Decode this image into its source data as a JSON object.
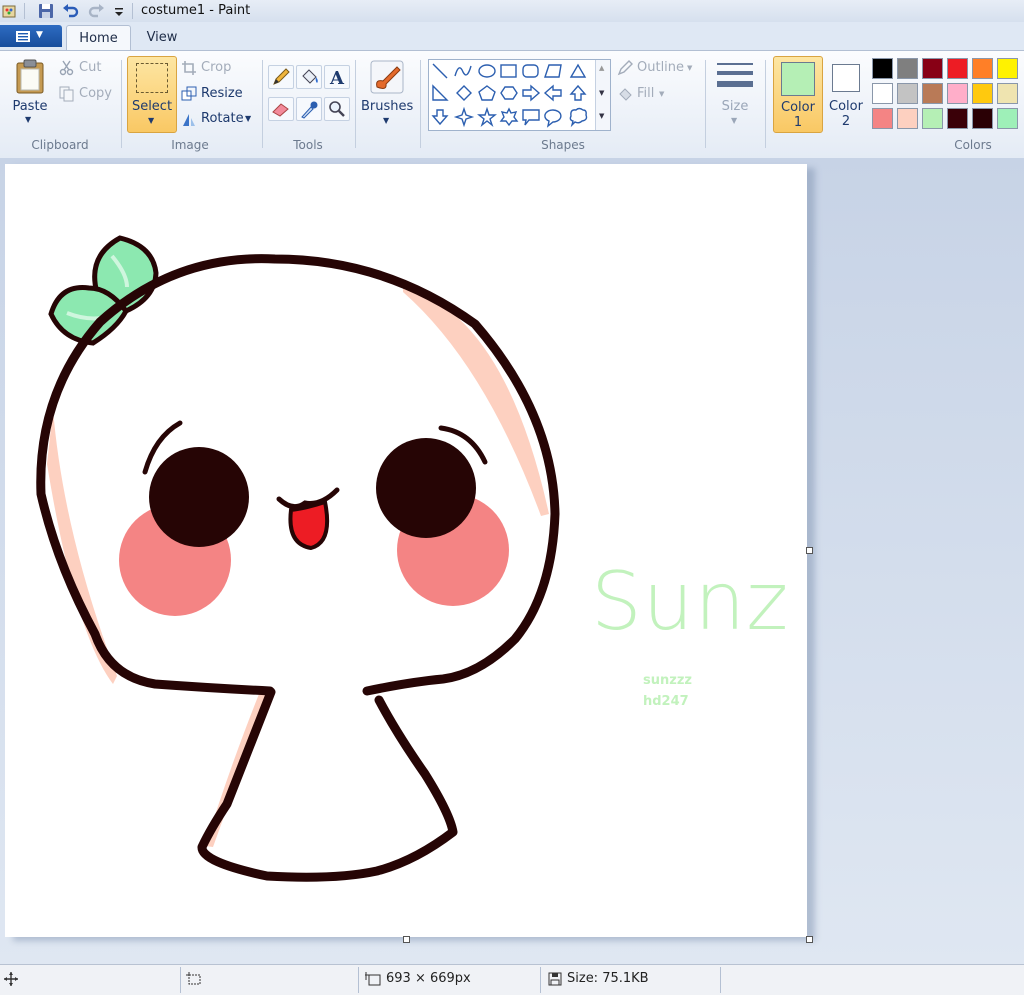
{
  "window": {
    "title": "costume1 - Paint"
  },
  "menu": {
    "tabs": [
      "Home",
      "View"
    ]
  },
  "ribbon": {
    "clipboard": {
      "group_label": "Clipboard",
      "paste": "Paste",
      "cut": "Cut",
      "copy": "Copy"
    },
    "image": {
      "group_label": "Image",
      "select": "Select",
      "crop": "Crop",
      "resize": "Resize",
      "rotate": "Rotate"
    },
    "tools": {
      "group_label": "Tools"
    },
    "brushes": {
      "label": "Brushes"
    },
    "shapes": {
      "group_label": "Shapes",
      "outline": "Outline",
      "fill": "Fill"
    },
    "size": {
      "label": "Size"
    },
    "colors": {
      "group_label": "Colors",
      "color1_label": "Color",
      "color1_num": "1",
      "color2_label": "Color",
      "color2_num": "2",
      "color1_value": "#b5efb5",
      "color2_value": "#ffffff",
      "palette": [
        "#000000",
        "#7f7f7f",
        "#880015",
        "#ed1c24",
        "#ff7f27",
        "#fff200",
        "#ffffff",
        "#c3c3c3",
        "#b97a57",
        "#ffaec9",
        "#ffc90e",
        "#efe4b0",
        "#f48484",
        "#fdd0c0",
        "#b5efb5",
        "#3a0008",
        "#2a0005",
        "#9ef0b8"
      ]
    }
  },
  "canvas": {
    "signature": "Sunz",
    "credit_line1": "sunzzz",
    "credit_line2": "hd247"
  },
  "status": {
    "dimensions": "693 × 669px",
    "size": "Size: 75.1KB"
  }
}
